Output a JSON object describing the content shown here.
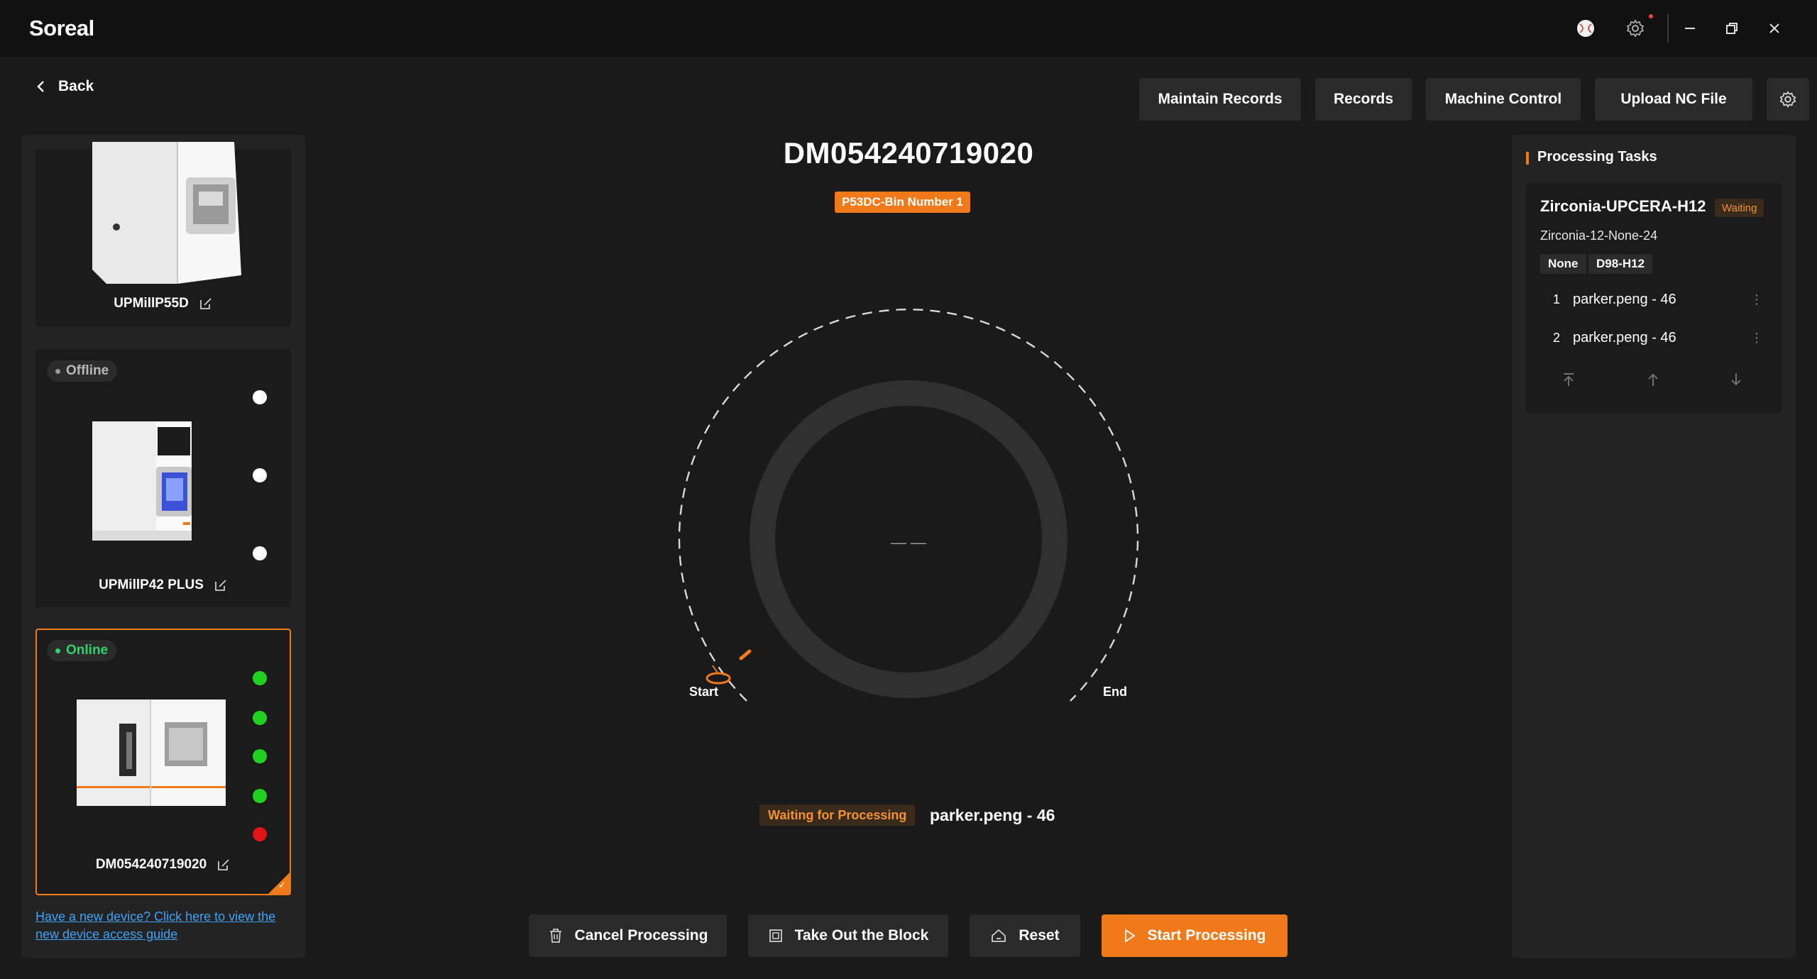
{
  "app": {
    "logo": "Soreal"
  },
  "nav": {
    "back_label": "Back"
  },
  "toolbar": {
    "maintain_records": "Maintain Records",
    "records": "Records",
    "machine_control": "Machine Control",
    "upload_nc_file": "Upload NC File"
  },
  "devices": [
    {
      "name": "UPMillP55D",
      "status": ""
    },
    {
      "name": "UPMillP42 PLUS",
      "status": "Offline"
    },
    {
      "name": "DM054240719020",
      "status": "Online"
    }
  ],
  "guide_link": "Have a new device? Click here to view the new device access guide",
  "main": {
    "device_title": "DM054240719020",
    "bin_label": "P53DC-Bin Number 1",
    "dial_center": "— —",
    "start_label": "Start",
    "end_label": "End",
    "wait_status": "Waiting for Processing",
    "wait_user": "parker.peng - 46"
  },
  "actions": {
    "cancel": "Cancel Processing",
    "take_out": "Take Out the Block",
    "reset": "Reset",
    "start": "Start Processing"
  },
  "tasks": {
    "title": "Processing Tasks",
    "name": "Zirconia-UPCERA-H12",
    "status": "Waiting",
    "sub": "Zirconia-12-None-24",
    "tags": [
      "None",
      "D98-H12"
    ],
    "rows": [
      {
        "num": "1",
        "user": "parker.peng - 46"
      },
      {
        "num": "2",
        "user": "parker.peng - 46"
      }
    ]
  },
  "colors": {
    "accent": "#f07a1a",
    "online": "#1fd21f",
    "error": "#e01414",
    "link": "#3da2f5"
  }
}
